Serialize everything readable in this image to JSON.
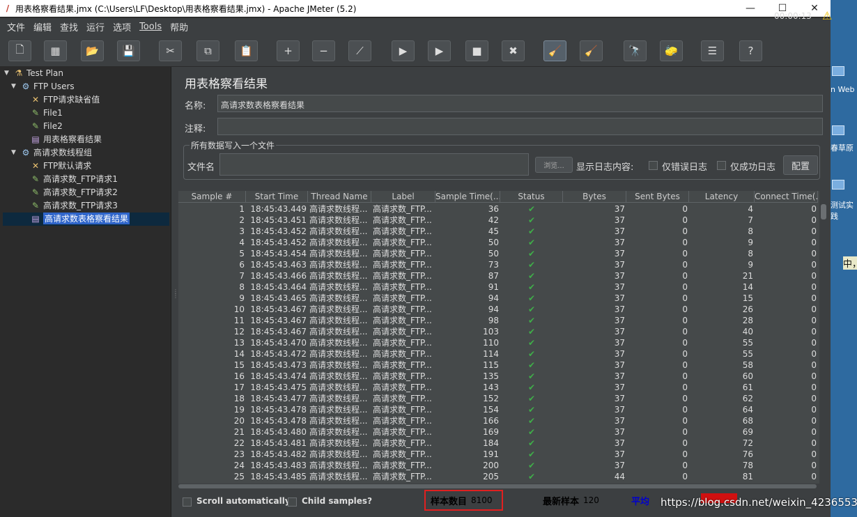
{
  "window": {
    "title": "用表格察看结果.jmx (C:\\Users\\LF\\Desktop\\用表格察看结果.jmx) - Apache JMeter (5.2)",
    "btn_min": "—",
    "btn_max": "☐",
    "btn_close": "✕"
  },
  "desktop": {
    "label1": "n Web",
    "label2": "春草原",
    "label3": "测试实",
    "label4": "践",
    "label5": "中，"
  },
  "menu": [
    "文件",
    "编辑",
    "查找",
    "运行",
    "选项",
    "Tools",
    "帮助"
  ],
  "toolbar": {
    "timer": "00:00:13",
    "warn_glyph": "⚠",
    "buttons": [
      {
        "name": "new-icon",
        "glyph": "🗋"
      },
      {
        "name": "templates-icon",
        "glyph": "▦"
      },
      {
        "name": "open-icon",
        "glyph": "📂"
      },
      {
        "name": "save-icon",
        "glyph": "💾"
      },
      {
        "name": "cut-icon",
        "glyph": "✂"
      },
      {
        "name": "copy-icon",
        "glyph": "⧉"
      },
      {
        "name": "paste-icon",
        "glyph": "📋"
      },
      {
        "name": "expand-icon",
        "glyph": "+"
      },
      {
        "name": "collapse-icon",
        "glyph": "−"
      },
      {
        "name": "toggle-icon",
        "glyph": "⟋"
      },
      {
        "name": "start-icon",
        "glyph": "▶"
      },
      {
        "name": "start-no-pause-icon",
        "glyph": "▶"
      },
      {
        "name": "stop-icon",
        "glyph": "■"
      },
      {
        "name": "shutdown-icon",
        "glyph": "✖"
      },
      {
        "name": "clear-icon",
        "glyph": "🧹"
      },
      {
        "name": "clear-all-icon",
        "glyph": "🧹"
      },
      {
        "name": "search-icon",
        "glyph": "🔭"
      },
      {
        "name": "reset-search-icon",
        "glyph": "🧽"
      },
      {
        "name": "function-helper-icon",
        "glyph": "☰"
      },
      {
        "name": "help-icon",
        "glyph": "?"
      }
    ]
  },
  "tree": [
    {
      "label": "Test Plan",
      "icon": "⚗",
      "exp": "▼"
    },
    {
      "label": "FTP Users",
      "icon": "⚙",
      "exp": "▼"
    },
    {
      "label": "FTP请求缺省值",
      "icon": "✕",
      "exp": ""
    },
    {
      "label": "File1",
      "icon": "✎",
      "exp": ""
    },
    {
      "label": "File2",
      "icon": "✎",
      "exp": ""
    },
    {
      "label": "用表格察看结果",
      "icon": "▤",
      "exp": ""
    },
    {
      "label": "高请求数线程组",
      "icon": "⚙",
      "exp": "▼"
    },
    {
      "label": "FTP默认请求",
      "icon": "✕",
      "exp": ""
    },
    {
      "label": "高请求数_FTP请求1",
      "icon": "✎",
      "exp": ""
    },
    {
      "label": "高请求数_FTP请求2",
      "icon": "✎",
      "exp": ""
    },
    {
      "label": "高请求数_FTP请求3",
      "icon": "✎",
      "exp": ""
    },
    {
      "label": "高请求数表格察看结果",
      "icon": "▤",
      "exp": ""
    }
  ],
  "panel": {
    "title": "用表格察看结果",
    "name_label": "名称:",
    "name_value": "高请求数表格察看结果",
    "comment_label": "注释:",
    "comment_value": "",
    "group_legend": "所有数据写入一个文件",
    "filename_label": "文件名",
    "filename_value": "",
    "browse": "浏览...",
    "log_label": "显示日志内容:",
    "errors_only": "仅错误日志",
    "success_only": "仅成功日志",
    "configure": "配置"
  },
  "table": {
    "headers": [
      "Sample #",
      "Start Time",
      "Thread Name",
      "Label",
      "Sample Time(...",
      "Status",
      "Bytes",
      "Sent Bytes",
      "Latency",
      "Connect Time(..."
    ],
    "thread": "高请求数线程...",
    "label": "高请求数_FTP...",
    "status_glyph": "✔",
    "rows": [
      [
        "1",
        "18:45:43.449",
        "36",
        "37",
        "0",
        "4",
        "0"
      ],
      [
        "2",
        "18:45:43.451",
        "42",
        "37",
        "0",
        "7",
        "0"
      ],
      [
        "3",
        "18:45:43.452",
        "45",
        "37",
        "0",
        "8",
        "0"
      ],
      [
        "4",
        "18:45:43.452",
        "50",
        "37",
        "0",
        "9",
        "0"
      ],
      [
        "5",
        "18:45:43.454",
        "50",
        "37",
        "0",
        "8",
        "0"
      ],
      [
        "6",
        "18:45:43.463",
        "73",
        "37",
        "0",
        "9",
        "0"
      ],
      [
        "7",
        "18:45:43.466",
        "87",
        "37",
        "0",
        "21",
        "0"
      ],
      [
        "8",
        "18:45:43.464",
        "91",
        "37",
        "0",
        "14",
        "0"
      ],
      [
        "9",
        "18:45:43.465",
        "94",
        "37",
        "0",
        "15",
        "0"
      ],
      [
        "10",
        "18:45:43.467",
        "94",
        "37",
        "0",
        "26",
        "0"
      ],
      [
        "11",
        "18:45:43.467",
        "98",
        "37",
        "0",
        "28",
        "0"
      ],
      [
        "12",
        "18:45:43.467",
        "103",
        "37",
        "0",
        "40",
        "0"
      ],
      [
        "13",
        "18:45:43.470",
        "110",
        "37",
        "0",
        "55",
        "0"
      ],
      [
        "14",
        "18:45:43.472",
        "114",
        "37",
        "0",
        "55",
        "0"
      ],
      [
        "15",
        "18:45:43.473",
        "115",
        "37",
        "0",
        "58",
        "0"
      ],
      [
        "16",
        "18:45:43.474",
        "135",
        "37",
        "0",
        "60",
        "0"
      ],
      [
        "17",
        "18:45:43.475",
        "143",
        "37",
        "0",
        "61",
        "0"
      ],
      [
        "18",
        "18:45:43.477",
        "152",
        "37",
        "0",
        "62",
        "0"
      ],
      [
        "19",
        "18:45:43.478",
        "154",
        "37",
        "0",
        "64",
        "0"
      ],
      [
        "20",
        "18:45:43.478",
        "166",
        "37",
        "0",
        "68",
        "0"
      ],
      [
        "21",
        "18:45:43.480",
        "169",
        "37",
        "0",
        "69",
        "0"
      ],
      [
        "22",
        "18:45:43.481",
        "184",
        "37",
        "0",
        "72",
        "0"
      ],
      [
        "23",
        "18:45:43.482",
        "191",
        "37",
        "0",
        "76",
        "0"
      ],
      [
        "24",
        "18:45:43.483",
        "200",
        "37",
        "0",
        "78",
        "0"
      ],
      [
        "25",
        "18:45:43.485",
        "205",
        "44",
        "0",
        "81",
        "0"
      ]
    ]
  },
  "footer": {
    "scroll_auto": "Scroll automatically?",
    "child_samples": "Child samples?",
    "sample_count_label": "样本数目",
    "sample_count": "8100",
    "latest_label": "最新样本",
    "latest": "120",
    "avg_label": "平均"
  },
  "watermark": "https://blog.csdn.net/weixin_42365530"
}
